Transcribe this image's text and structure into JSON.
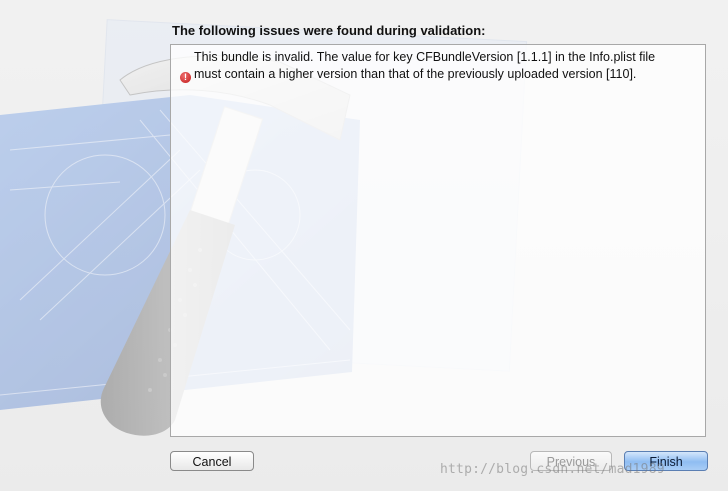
{
  "dialog": {
    "heading": "The following issues were found during validation:",
    "issues": [
      {
        "severity_icon": "error-icon",
        "text": "This bundle is invalid. The value for key CFBundleVersion [1.1.1] in the Info.plist file must contain a higher version than that of the previously uploaded version [110]."
      }
    ],
    "buttons": {
      "cancel": "Cancel",
      "previous": "Previous",
      "finish": "Finish"
    }
  },
  "watermark": "http://blog.csdn.net/mad1989",
  "colors": {
    "blueprint": "#3f6fc9",
    "error_red": "#c01818",
    "default_button": "#8fbdf2"
  }
}
